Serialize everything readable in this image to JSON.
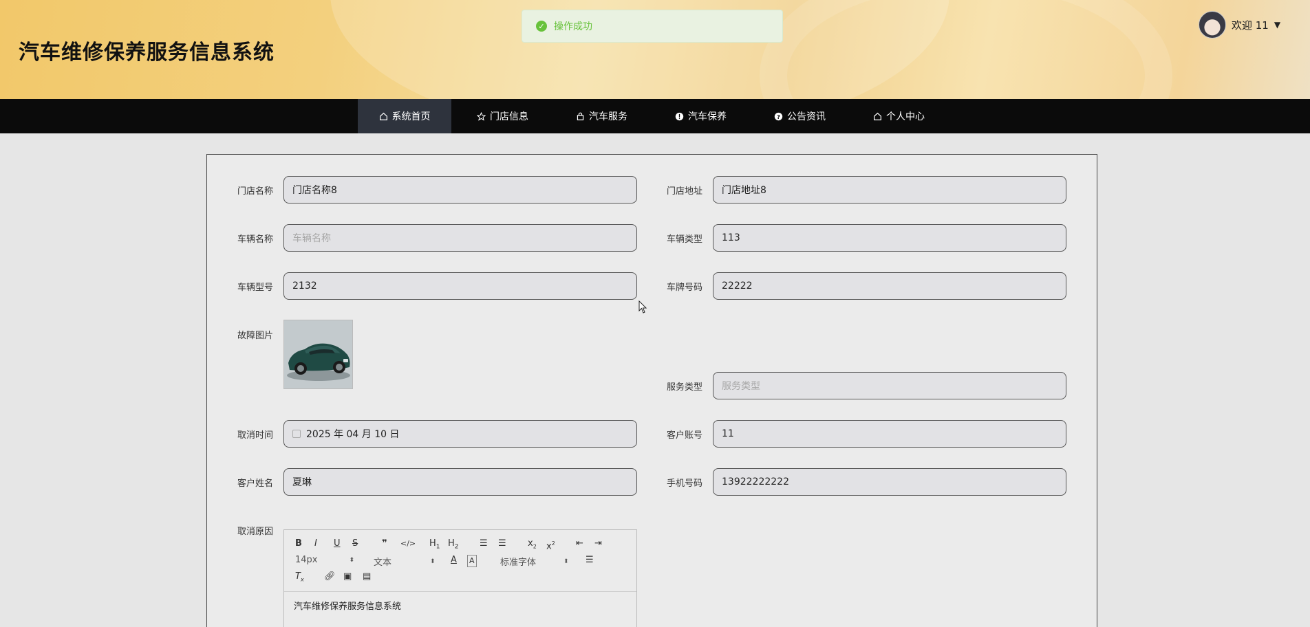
{
  "header": {
    "title": "汽车维修保养服务信息系统",
    "welcome": "欢迎 11",
    "bg_colors": [
      "#f2c86a",
      "#f8e3b0"
    ]
  },
  "toast": {
    "message": "操作成功",
    "color": "#67c23a"
  },
  "nav": {
    "items": [
      {
        "label": "系统首页",
        "icon": "home-icon"
      },
      {
        "label": "门店信息",
        "icon": "star-icon"
      },
      {
        "label": "汽车服务",
        "icon": "bag-icon"
      },
      {
        "label": "汽车保养",
        "icon": "info-icon"
      },
      {
        "label": "公告资讯",
        "icon": "question-icon"
      },
      {
        "label": "个人中心",
        "icon": "home-icon"
      }
    ],
    "active_index": 0
  },
  "form": {
    "store_name": {
      "label": "门店名称",
      "value": "门店名称8"
    },
    "store_address": {
      "label": "门店地址",
      "value": "门店地址8"
    },
    "vehicle_name": {
      "label": "车辆名称",
      "value": "",
      "placeholder": "车辆名称"
    },
    "vehicle_type": {
      "label": "车辆类型",
      "value": "113"
    },
    "vehicle_model": {
      "label": "车辆型号",
      "value": "2132"
    },
    "plate_number": {
      "label": "车牌号码",
      "value": "22222"
    },
    "fault_image": {
      "label": "故障图片"
    },
    "service_type": {
      "label": "服务类型",
      "value": "",
      "placeholder": "服务类型"
    },
    "cancel_time": {
      "label": "取消时间",
      "value": "2025 年 04 月 10 日"
    },
    "customer_account": {
      "label": "客户账号",
      "value": "11"
    },
    "customer_name": {
      "label": "客户姓名",
      "value": "夏琳"
    },
    "phone": {
      "label": "手机号码",
      "value": "13922222222"
    },
    "cancel_reason": {
      "label": "取消原因",
      "content": "汽车维修保养服务信息系统",
      "toolbar": {
        "font_size": "14px",
        "text_style": "文本",
        "font_family": "标准字体"
      }
    }
  }
}
